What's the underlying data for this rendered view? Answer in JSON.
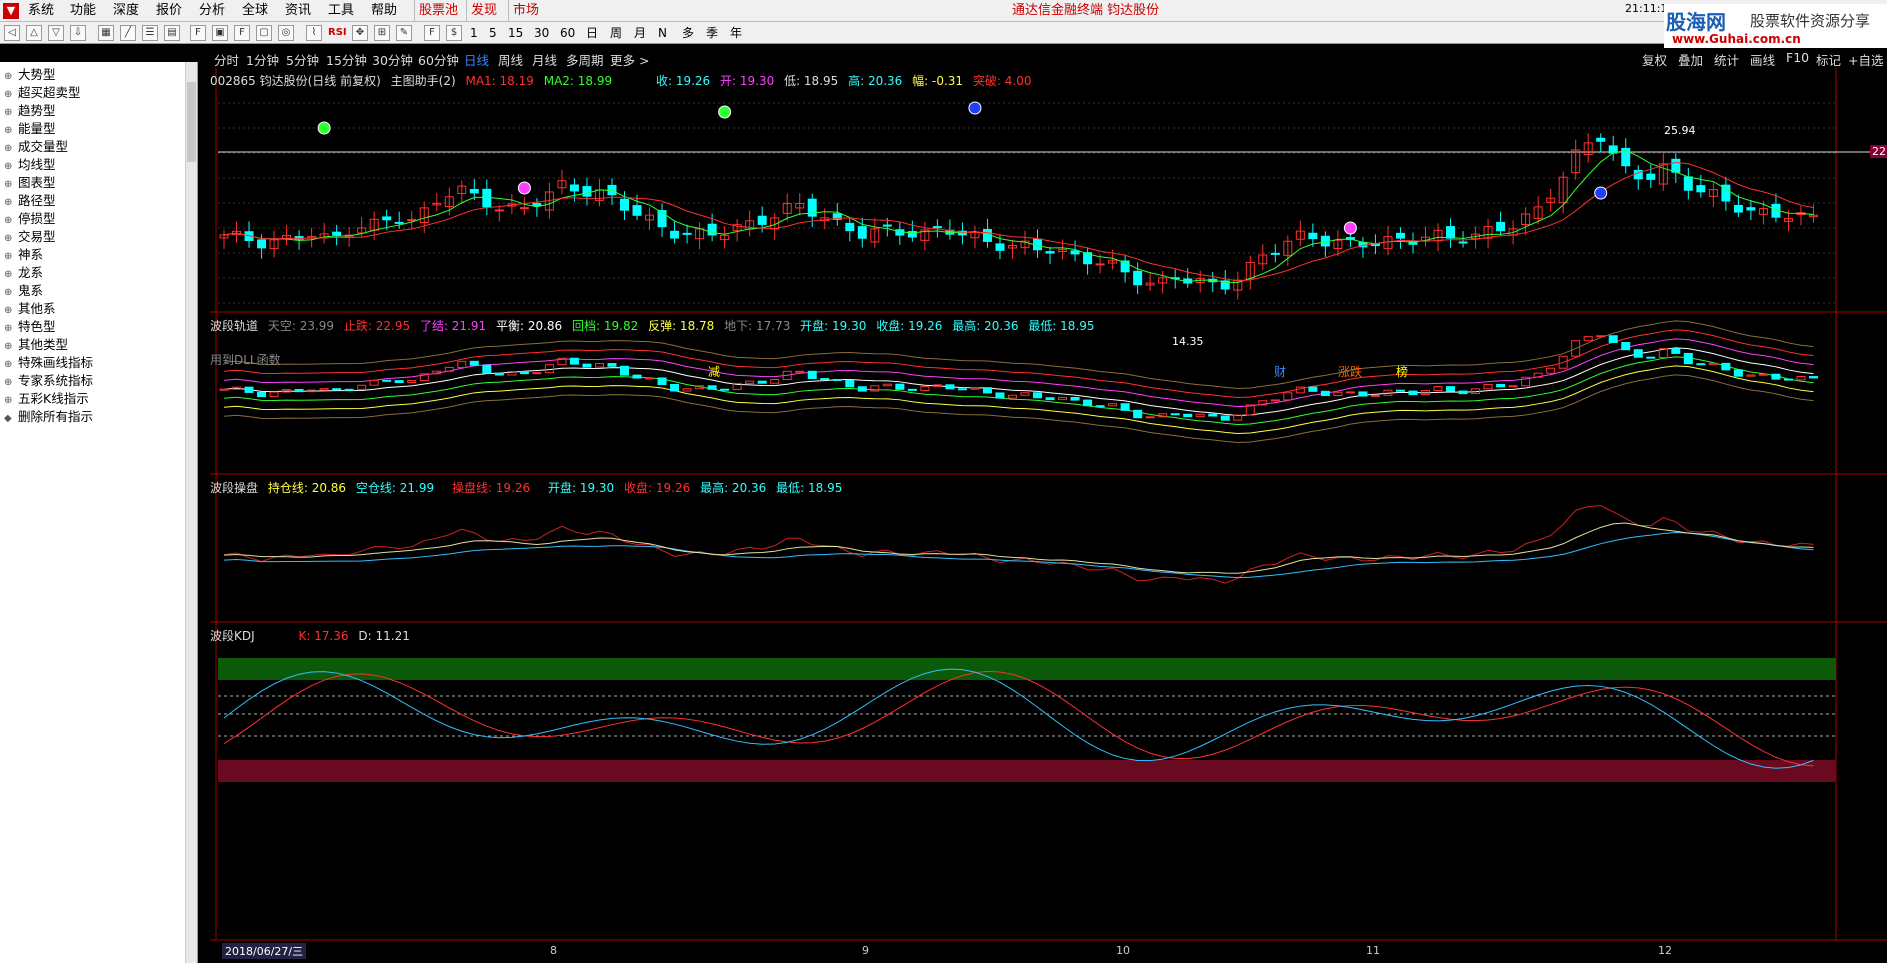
{
  "menu": {
    "items": [
      "系统",
      "功能",
      "深度",
      "报价",
      "分析",
      "全球",
      "资讯",
      "工具",
      "帮助"
    ],
    "highlight_items": [
      "股票池",
      "发现",
      "市场"
    ],
    "center_title": "通达信金融终端  钧达股份",
    "clock": "21:11:13"
  },
  "brand": {
    "name": "股海网",
    "tagline": "股票软件资源分享",
    "url": "www.Guhai.com.cn"
  },
  "toolbar": {
    "rsi_label": "RSI",
    "numbers": [
      "1",
      "5",
      "15",
      "30",
      "60"
    ],
    "periods": [
      "日",
      "周",
      "月",
      "N",
      "多",
      "季",
      "年"
    ]
  },
  "left_panel": {
    "items": [
      "大势型",
      "超买超卖型",
      "趋势型",
      "能量型",
      "成交量型",
      "均线型",
      "图表型",
      "路径型",
      "停损型",
      "交易型",
      "神系",
      "龙系",
      "鬼系",
      "其他系",
      "特色型",
      "其他类型",
      "特殊画线指标",
      "专家系统指标",
      "五彩K线指示",
      "删除所有指示"
    ]
  },
  "period_bar": {
    "items": [
      "分时",
      "1分钟",
      "5分钟",
      "15分钟",
      "30分钟",
      "60分钟",
      "日线",
      "周线",
      "月线",
      "多周期",
      "更多 >"
    ],
    "selected": "日线",
    "right_items": [
      "复权",
      "叠加",
      "统计",
      "画线",
      "F10",
      "标记",
      "+自选"
    ]
  },
  "main_panel": {
    "stock": "002865 钧达股份(日线 前复权)",
    "helper": "主图助手(2)",
    "ma1": "MA1: 18.19",
    "ma2": "MA2: 18.99",
    "close": "收: 19.26",
    "open": "开: 19.30",
    "low": "低: 18.95",
    "high": "高: 20.36",
    "change": "幅: -0.31",
    "breakout": "突破: 4.00",
    "price_label_high": "25.94",
    "price_label_low": "14.35",
    "price_right": "22.",
    "dll_note": "用到DLL函数",
    "markers": [
      "减",
      "财",
      "涨跌",
      "榜"
    ]
  },
  "panel2": {
    "name": "波段轨道",
    "fields": [
      "天空: 23.99",
      "止跌: 22.95",
      "了结: 21.91",
      "平衡: 20.86",
      "回档: 19.82",
      "反弹: 18.78",
      "地下: 17.73",
      "开盘: 19.30",
      "收盘: 19.26",
      "最高: 20.36",
      "最低: 18.95"
    ]
  },
  "panel3": {
    "name": "波段操盘",
    "fields": [
      "持仓线: 20.86",
      "空仓线: 21.99",
      "操盘线: 19.26",
      "开盘: 19.30",
      "收盘: 19.26",
      "最高: 20.36",
      "最低: 18.95"
    ]
  },
  "panel4": {
    "name": "波段KDJ",
    "k": "K: 17.36",
    "d": "D: 11.21"
  },
  "time_axis": {
    "start_date": "2018/06/27/三",
    "months": [
      "8",
      "9",
      "10",
      "11",
      "12"
    ]
  },
  "colors": {
    "up": "#ff3030",
    "down": "#00ffff",
    "ma1": "#ff3030",
    "ma2": "#30ff30",
    "sell_marker": "#2040ff",
    "buy_marker": "#ff40ff"
  }
}
